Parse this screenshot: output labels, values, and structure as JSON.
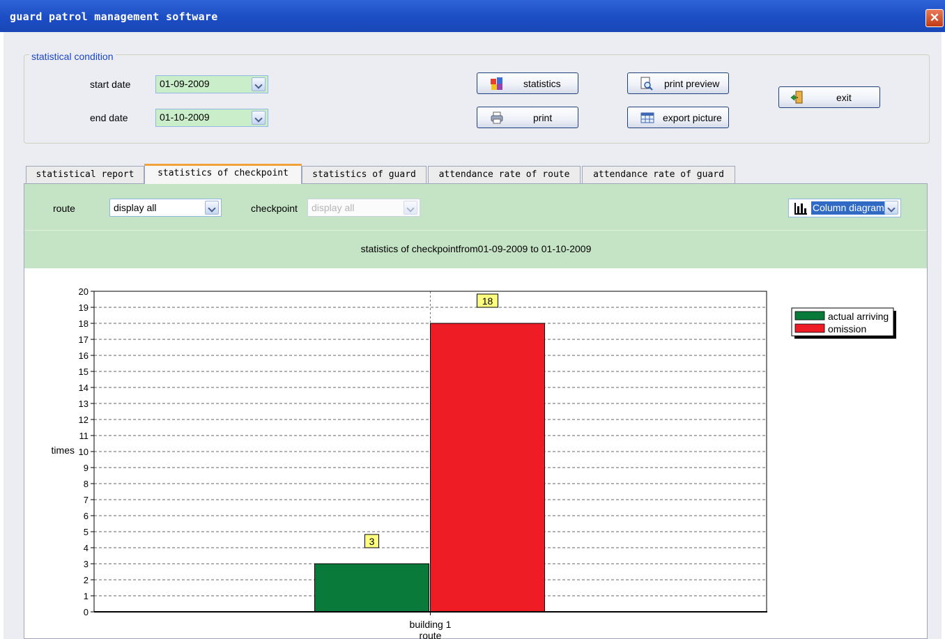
{
  "window": {
    "title": "guard patrol management software",
    "close_glyph": "✕"
  },
  "condition": {
    "group_label": "statistical condition",
    "start_label": "start date",
    "start_value": "01-09-2009",
    "end_label": "end date",
    "end_value": "01-10-2009"
  },
  "buttons": {
    "statistics": "statistics",
    "print": "print",
    "print_preview": "print preview",
    "export_picture": "export picture",
    "exit": "exit"
  },
  "tabs": [
    {
      "label": "statistical report",
      "active": false
    },
    {
      "label": "statistics of checkpoint",
      "active": true
    },
    {
      "label": "statistics of guard",
      "active": false
    },
    {
      "label": "attendance rate of route",
      "active": false
    },
    {
      "label": "attendance rate of guard",
      "active": false
    }
  ],
  "filters": {
    "route_label": "route",
    "route_value": "display all",
    "checkpoint_label": "checkpoint",
    "checkpoint_value": "display all",
    "chart_type": "Column diagram"
  },
  "chart_heading": "statistics of checkpointfrom01-09-2009 to 01-10-2009",
  "chart_data": {
    "type": "bar",
    "categories": [
      "building 1"
    ],
    "series": [
      {
        "name": "actual arriving",
        "values": [
          3
        ],
        "color": "#0a7a3a"
      },
      {
        "name": "omission",
        "values": [
          18
        ],
        "color": "#ee1c24"
      }
    ],
    "xlabel": "route",
    "ylabel": "times",
    "ylim": [
      0,
      20
    ],
    "yticks": [
      0,
      1,
      2,
      3,
      4,
      5,
      6,
      7,
      8,
      9,
      10,
      11,
      12,
      13,
      14,
      15,
      16,
      17,
      18,
      19,
      20
    ],
    "grid": true,
    "legend": "top-right",
    "data_labels": true
  }
}
